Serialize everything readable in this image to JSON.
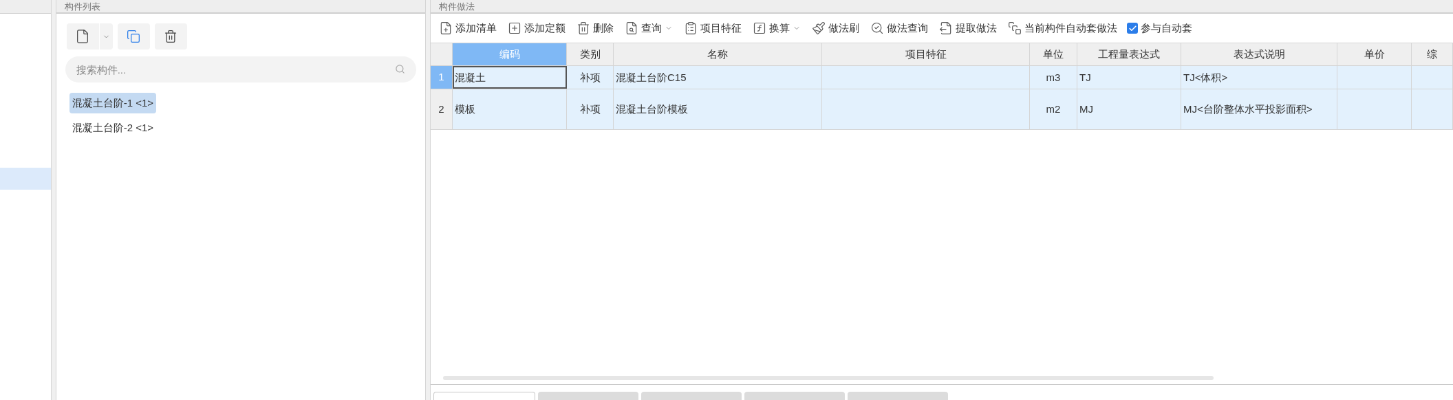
{
  "left_pane": {
    "row_selected": true
  },
  "component_list": {
    "title": "构件列表",
    "search": {
      "placeholder": "搜索构件..."
    },
    "items": [
      {
        "label": "混凝土台阶-1 <1>",
        "selected": true
      },
      {
        "label": "混凝土台阶-2 <1>",
        "selected": false
      }
    ]
  },
  "methods": {
    "title": "构件做法",
    "toolbar": [
      {
        "label": "添加清单",
        "kind": "button"
      },
      {
        "label": "添加定额",
        "kind": "button"
      },
      {
        "label": "删除",
        "kind": "button"
      },
      {
        "label": "查询",
        "kind": "dropdown"
      },
      {
        "label": "项目特征",
        "kind": "button"
      },
      {
        "label": "换算",
        "kind": "dropdown"
      },
      {
        "label": "做法刷",
        "kind": "button"
      },
      {
        "label": "做法查询",
        "kind": "button"
      },
      {
        "label": "提取做法",
        "kind": "button"
      },
      {
        "label": "当前构件自动套做法",
        "kind": "button"
      },
      {
        "label": "参与自动套",
        "kind": "checkbox",
        "checked": true
      }
    ],
    "table": {
      "columns": [
        {
          "label": "编码",
          "selected": true
        },
        {
          "label": "类别",
          "selected": false
        },
        {
          "label": "名称",
          "selected": false
        },
        {
          "label": "项目特征",
          "selected": false
        },
        {
          "label": "单位",
          "selected": false
        },
        {
          "label": "工程量表达式",
          "selected": false
        },
        {
          "label": "表达式说明",
          "selected": false
        },
        {
          "label": "单价",
          "selected": false
        },
        {
          "label": "综",
          "selected": false
        }
      ],
      "rows": [
        {
          "number": "1",
          "selected": true,
          "cells": [
            "混凝土",
            "补项",
            "混凝土台阶C15",
            "",
            "m3",
            "TJ",
            "TJ<体积>",
            "",
            ""
          ]
        },
        {
          "number": "2",
          "selected": false,
          "cells": [
            "模板",
            "补项",
            "混凝土台阶模板",
            "",
            "m2",
            "MJ",
            "MJ<台阶整体水平投影面积>",
            "",
            ""
          ]
        }
      ]
    }
  },
  "bottom_tabs": [
    {
      "selected": true
    },
    {
      "selected": false
    },
    {
      "selected": false
    },
    {
      "selected": false
    },
    {
      "selected": false
    }
  ]
}
